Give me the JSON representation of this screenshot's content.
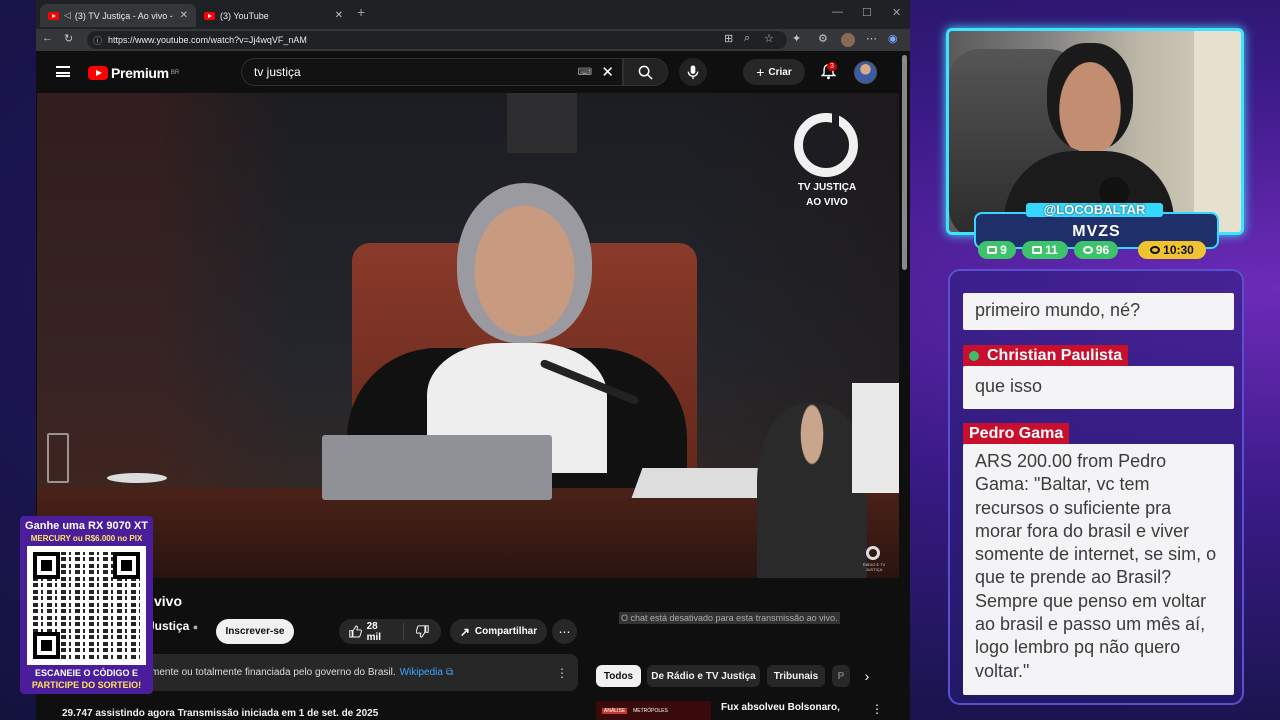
{
  "browser": {
    "tabs": [
      {
        "label": "(3) TV Justiça - Ao vivo - You",
        "active": true
      },
      {
        "label": "(3) YouTube",
        "active": false
      }
    ],
    "url": "https://www.youtube.com/watch?v=Jj4wqVF_nAM"
  },
  "youtube": {
    "brand": "Premium",
    "region": "BR",
    "search_value": "tv justiça",
    "create_label": "Criar",
    "notifications": "3",
    "video_overlay": {
      "line1": "TV JUSTIÇA",
      "line2": "AO VIVO",
      "small_logo_text": "RÁDIO E TV JUSTIÇA"
    },
    "title_fragment": "vivo",
    "channel_fragment": "Justiça",
    "subscribe_label": "Inscrever-se",
    "likes": "28 mil",
    "share_label": "Compartilhar",
    "notice_text": "mente ou totalmente financiada pelo governo do Brasil.",
    "notice_link": "Wikipedia",
    "stats": "29.747 assistindo agora  Transmissão iniciada em 1 de set. de 2025",
    "chat_disabled": "O chat está desativado para esta transmissão ao vivo.",
    "chips": [
      "Todos",
      "De Rádio e TV Justiça",
      "Tribunais",
      "P"
    ],
    "rec_tag": "ANÁLISE",
    "rec_source": "METRÓPOLES",
    "rec_title": "Fux absolveu Bolsonaro,"
  },
  "promo": {
    "line1": "Ganhe uma RX 9070 XT",
    "line2": "MERCURY ou R$6.000 no PIX",
    "bottom1": "ESCANEIE O CÓDIGO E",
    "bottom2": "PARTICIPE DO SORTEIO!"
  },
  "stream": {
    "handle": "@LOCOBALTAR",
    "name": "MVZS",
    "stats": [
      {
        "icon": "chat-icon",
        "value": "9",
        "color": "#3dc46b"
      },
      {
        "icon": "youtube-icon",
        "value": "11",
        "color": "#3dc46b"
      },
      {
        "icon": "viewers-icon",
        "value": "96",
        "color": "#3dc46b"
      },
      {
        "icon": "clock-icon",
        "value": "10:30",
        "color": "#f0c330"
      }
    ]
  },
  "chat": {
    "messages": [
      {
        "author": "",
        "text": "primeiro mundo, né?"
      },
      {
        "author": "Christian Paulista",
        "text": "que isso"
      },
      {
        "author": "Pedro Gama",
        "text": "ARS 200.00 from Pedro Gama: \"Baltar, vc tem recursos o suficiente pra morar fora do brasil e viver somente de internet, se sim, o que te prende ao Brasil? Sempre que penso em voltar ao brasil e passo um mês aí, logo lembro pq não quero voltar.\""
      }
    ]
  }
}
